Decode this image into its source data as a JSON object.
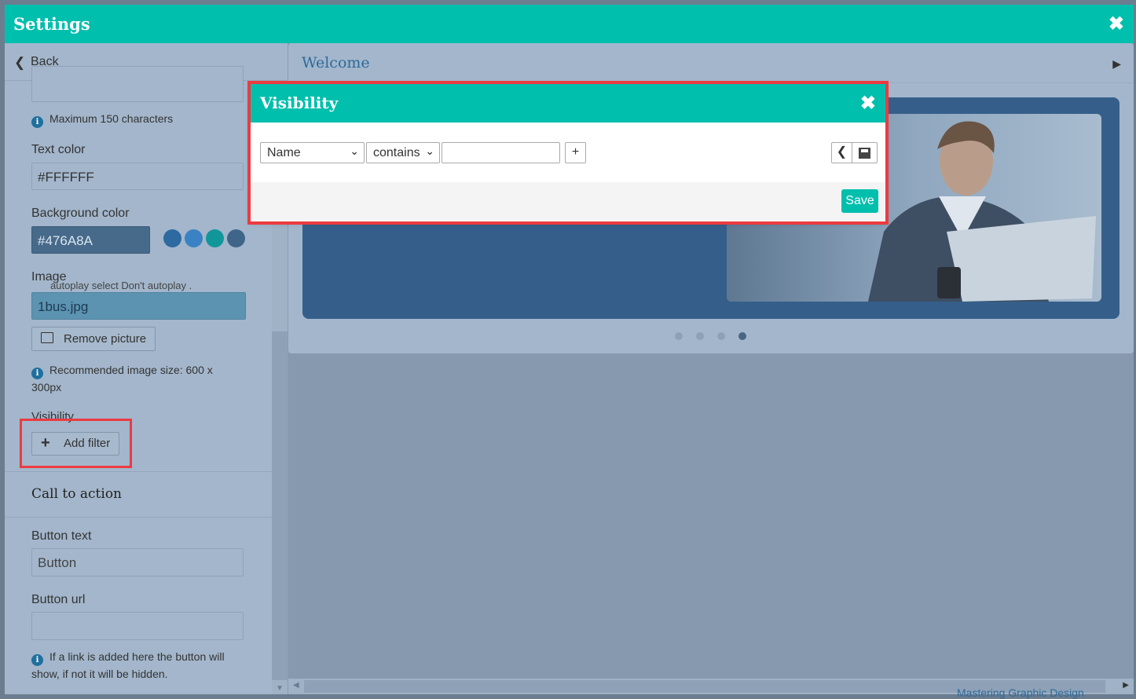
{
  "window": {
    "title": "Settings"
  },
  "left_panel": {
    "back_label": "Back",
    "max_chars_info": "Maximum 150 characters",
    "text_color": {
      "label": "Text color",
      "value": "#FFFFFF"
    },
    "background_color": {
      "label": "Background color",
      "value": "#476A8A",
      "swatches": [
        "#2c6aa0",
        "#3a82c4",
        "#11979a",
        "#3f6589"
      ]
    },
    "image": {
      "label": "Image",
      "overlap_text": "autoplay select  Don't autoplay .",
      "value": "1bus.jpg",
      "remove_label": "Remove picture",
      "info": "Recommended image size: 600 x 300px"
    },
    "visibility": {
      "label": "Visibility",
      "add_filter_label": "Add filter"
    },
    "call_to_action": {
      "heading": "Call to action",
      "button_text": {
        "label": "Button text",
        "value": "Button"
      },
      "button_url": {
        "label": "Button url",
        "value": ""
      },
      "info": "If a link is added here the button will show, if not it will be hidden."
    }
  },
  "preview": {
    "section_title": "Welcome",
    "pager_dots": 4,
    "active_dot": 4,
    "background_peek_text": "Mastering Graphic Design"
  },
  "dialog": {
    "title": "Visibility",
    "field_select": "Name",
    "operator_select": "contains",
    "value_input": "",
    "add_label": "+",
    "save_label": "Save"
  }
}
